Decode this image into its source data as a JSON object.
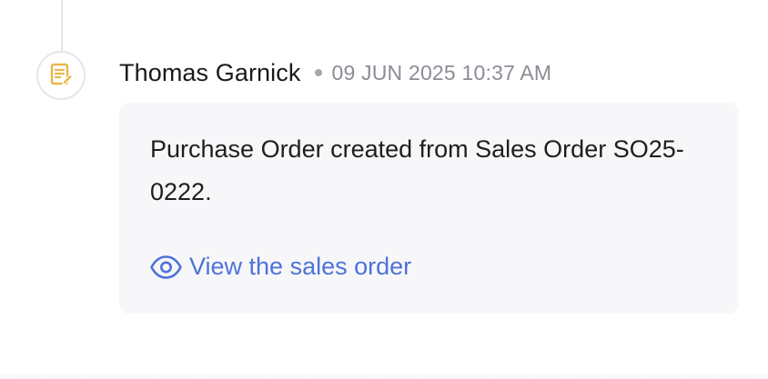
{
  "activity": {
    "icon": "document-edit-icon",
    "author": "Thomas Garnick",
    "timestamp": "09 JUN 2025 10:37 AM",
    "message": "Purchase Order created from Sales Order SO25-0222.",
    "link": {
      "icon": "eye-icon",
      "label": "View the sales order"
    }
  },
  "colors": {
    "icon_accent": "#e7b84a",
    "link": "#4f72d8",
    "card_background": "#f7f7f9",
    "timestamp": "#8a8d96"
  }
}
